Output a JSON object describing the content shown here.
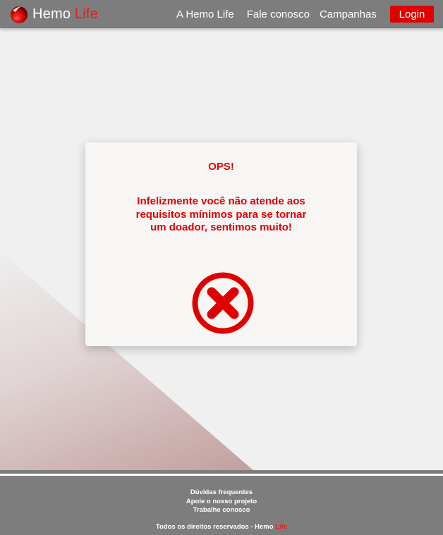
{
  "header": {
    "brand_primary": "Hemo",
    "brand_accent": "Life",
    "nav": [
      {
        "label": "A Hemo Life"
      },
      {
        "label": "Fale conosco"
      },
      {
        "label": "Campanhas"
      }
    ],
    "login_label": "Login"
  },
  "modal": {
    "title": "OPS!",
    "message": "Infelizmente você não atende aos requisitos mínimos para se tornar um doador, sentimos muito!",
    "icon": "error-x-icon"
  },
  "footer": {
    "links": [
      {
        "label": "Dúvidas frequentes"
      },
      {
        "label": "Apoie o nosso projeto"
      },
      {
        "label": "Trabalhe conosco"
      }
    ],
    "copyright_prefix": "Todos os direitos reservados - Hemo",
    "copyright_accent": "Life"
  },
  "colors": {
    "accent": "#e00000",
    "bar": "#7d7d7d",
    "background": "#f0f0f0"
  }
}
